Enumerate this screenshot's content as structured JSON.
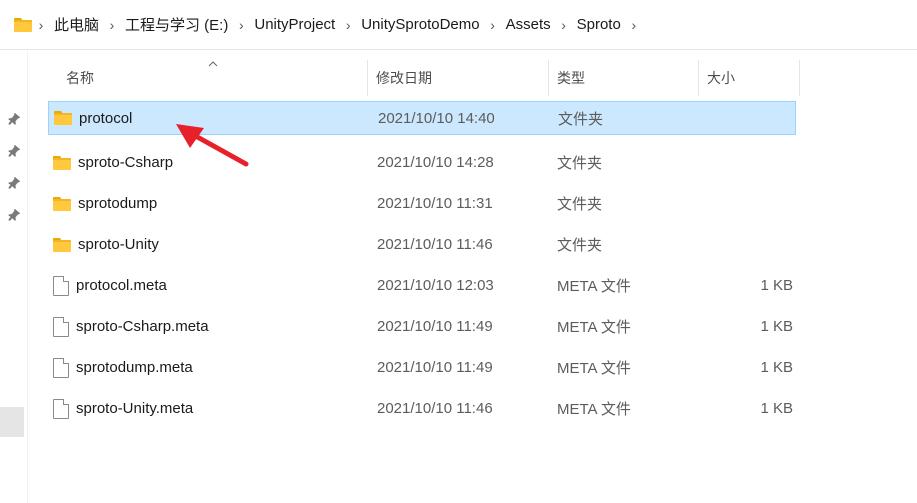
{
  "breadcrumb": {
    "items": [
      {
        "label": "此电脑"
      },
      {
        "label": "工程与学习 (E:)"
      },
      {
        "label": "UnityProject"
      },
      {
        "label": "UnitySprotoDemo"
      },
      {
        "label": "Assets"
      },
      {
        "label": "Sproto"
      }
    ],
    "separator": "›"
  },
  "columns": {
    "name": "名称",
    "date": "修改日期",
    "type": "类型",
    "size": "大小"
  },
  "rows": [
    {
      "name": "protocol",
      "date": "2021/10/10 14:40",
      "type": "文件夹",
      "size": "",
      "kind": "folder",
      "selected": true
    },
    {
      "name": "sproto-Csharp",
      "date": "2021/10/10 14:28",
      "type": "文件夹",
      "size": "",
      "kind": "folder"
    },
    {
      "name": "sprotodump",
      "date": "2021/10/10 11:31",
      "type": "文件夹",
      "size": "",
      "kind": "folder"
    },
    {
      "name": "sproto-Unity",
      "date": "2021/10/10 11:46",
      "type": "文件夹",
      "size": "",
      "kind": "folder"
    },
    {
      "name": "protocol.meta",
      "date": "2021/10/10 12:03",
      "type": "META 文件",
      "size": "1 KB",
      "kind": "file"
    },
    {
      "name": "sproto-Csharp.meta",
      "date": "2021/10/10 11:49",
      "type": "META 文件",
      "size": "1 KB",
      "kind": "file"
    },
    {
      "name": "sprotodump.meta",
      "date": "2021/10/10 11:49",
      "type": "META 文件",
      "size": "1 KB",
      "kind": "file"
    },
    {
      "name": "sproto-Unity.meta",
      "date": "2021/10/10 11:46",
      "type": "META 文件",
      "size": "1 KB",
      "kind": "file"
    }
  ],
  "icons": {
    "location": "folder-icon",
    "pins": "pin-icon",
    "sort": "sort-up-icon",
    "annotation": "red-arrow-annotation"
  },
  "colors": {
    "selection_bg": "#cce8ff",
    "selection_border": "#99d1ff",
    "folder": "#ffc83d",
    "annotation": "#e8202a"
  }
}
